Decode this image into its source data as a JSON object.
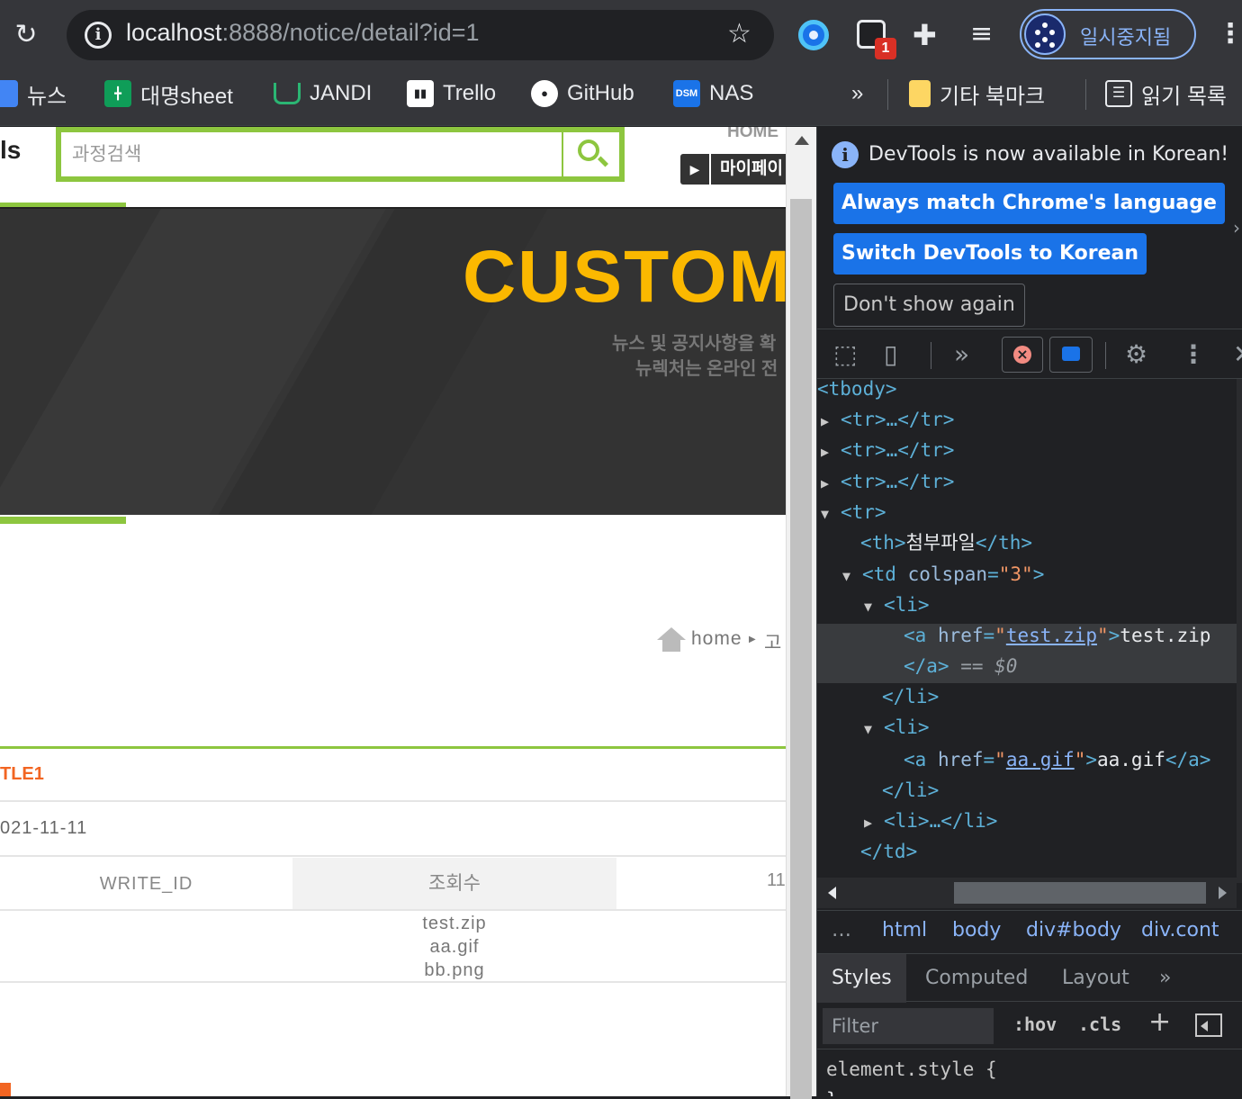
{
  "browser": {
    "url_host": "localhost",
    "url_rest": ":8888/notice/detail?id=1",
    "extension_badge": "1",
    "profile_label": "일시중지됨"
  },
  "bookmarks": [
    {
      "label": "뉴스",
      "icon": "news-icon",
      "color": "#4285f4"
    },
    {
      "label": "대명sheet",
      "icon": "sheets-icon",
      "color": "#0f9d58"
    },
    {
      "label": "JANDI",
      "icon": "jandi-icon",
      "color": "#2bb673"
    },
    {
      "label": "Trello",
      "icon": "trello-icon",
      "color": "#ffffff"
    },
    {
      "label": "GitHub",
      "icon": "github-icon",
      "color": "#ffffff"
    },
    {
      "label": "NAS",
      "icon": "dsm-icon",
      "color": "#1a73e8"
    }
  ],
  "bookmarks_more": "»",
  "bookmark_folder": "기타 북마크",
  "reading_list": "읽기 목록",
  "site": {
    "logo_fragment": "ls",
    "search_placeholder": "과정검색",
    "home_link": "HOME",
    "mypage": "마이페이",
    "banner_title": "CUSTOM",
    "banner_sub1": "뉴스 및 공지사항을 확",
    "banner_sub2": "뉴렉처는 온라인 전",
    "crumb_home": "home",
    "crumb_next": "고",
    "notice": {
      "title": "TLE1",
      "date": "021-11-11",
      "writer": "WRITE_ID",
      "views_label": "조회수",
      "views": "11",
      "files": [
        "test.zip",
        "aa.gif",
        "bb.png"
      ]
    }
  },
  "devtools": {
    "banner_message": "DevTools is now available in Korean!",
    "btn_match": "Always match Chrome's language",
    "btn_switch": "Switch DevTools to Korean",
    "btn_dont_show": "Don't show again",
    "dom": {
      "tbody": "<tbody>",
      "tr_collapsed": "<tr>…</tr>",
      "tr_open": "<tr>",
      "th_open": "<th>",
      "th_text": "첨부파일",
      "th_close": "</th>",
      "td_open": "<td ",
      "td_attr": "colspan",
      "td_val": "\"3\"",
      "td_gt": ">",
      "li_open": "<li>",
      "a_open": "<a ",
      "href": "href",
      "eq": "=",
      "href1": "test.zip",
      "text1": "test.zip",
      "a_close": "</a>",
      "selected_marker": " == $0",
      "li_close": "</li>",
      "href2": "aa.gif",
      "text2": "aa.gif",
      "li_collapsed": "<li>…</li>",
      "td_close": "</td>"
    },
    "crumbs": [
      "…",
      "html",
      "body",
      "div#body",
      "div.cont"
    ],
    "tabs": [
      "Styles",
      "Computed",
      "Layout",
      "»"
    ],
    "filter_placeholder": "Filter",
    "hov": ":hov",
    "cls": ".cls",
    "element_style": "element.style {",
    "element_style_close": "}"
  }
}
